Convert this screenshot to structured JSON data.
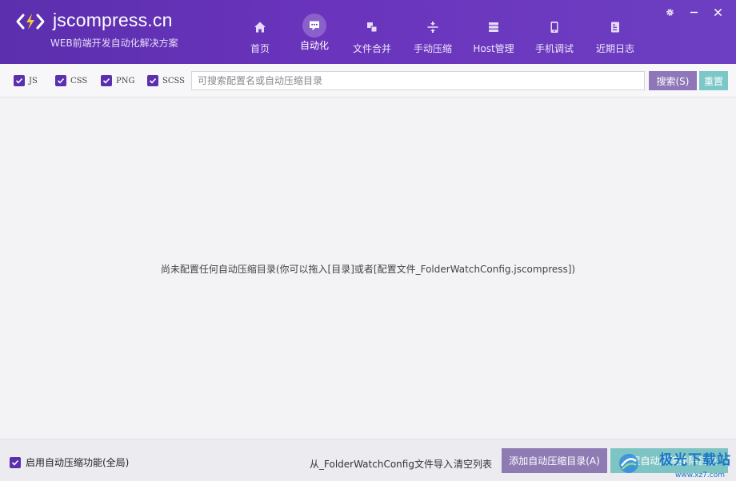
{
  "app": {
    "title": "jscompress.cn",
    "subtitle": "WEB前端开发自动化解决方案"
  },
  "nav": [
    {
      "label": "首页",
      "icon": "home-icon",
      "active": false
    },
    {
      "label": "自动化",
      "icon": "chat-icon",
      "active": true
    },
    {
      "label": "文件合并",
      "icon": "merge-icon",
      "active": false
    },
    {
      "label": "手动压缩",
      "icon": "compress-icon",
      "active": false
    },
    {
      "label": "Host管理",
      "icon": "server-icon",
      "active": false
    },
    {
      "label": "手机调试",
      "icon": "phone-icon",
      "active": false
    },
    {
      "label": "近期日志",
      "icon": "log-icon",
      "active": false
    }
  ],
  "window_controls": [
    "gear-icon",
    "minimize-icon",
    "close-icon"
  ],
  "filters": [
    {
      "label": "JS",
      "checked": true
    },
    {
      "label": "CSS",
      "checked": true
    },
    {
      "label": "PNG",
      "checked": true
    },
    {
      "label": "SCSS",
      "checked": true
    }
  ],
  "search": {
    "placeholder": "可搜索配置名或自动压缩目录",
    "value": "",
    "search_label": "搜索(S)",
    "reset_label": "重置"
  },
  "content": {
    "empty_message": "尚未配置任何自动压缩目录(你可以拖入[目录]或者[配置文件_FolderWatchConfig.jscompress])"
  },
  "footer": {
    "enable_label": "启用自动压缩功能(全局)",
    "enable_checked": true,
    "import_label": "从_FolderWatchConfig文件导入",
    "clear_label": "清空列表",
    "add_label": "添加自动压缩目录(A)",
    "exclude_label": "设置自动压缩排除目录"
  },
  "watermark": {
    "text": "极光下载站",
    "url": "www.xz7.com"
  },
  "colors": {
    "brand": "#5b2fae",
    "header_end": "#6d3fc2",
    "accent_purple_btn": "#8f7bb3",
    "accent_teal_btn": "#7fc4c4"
  }
}
